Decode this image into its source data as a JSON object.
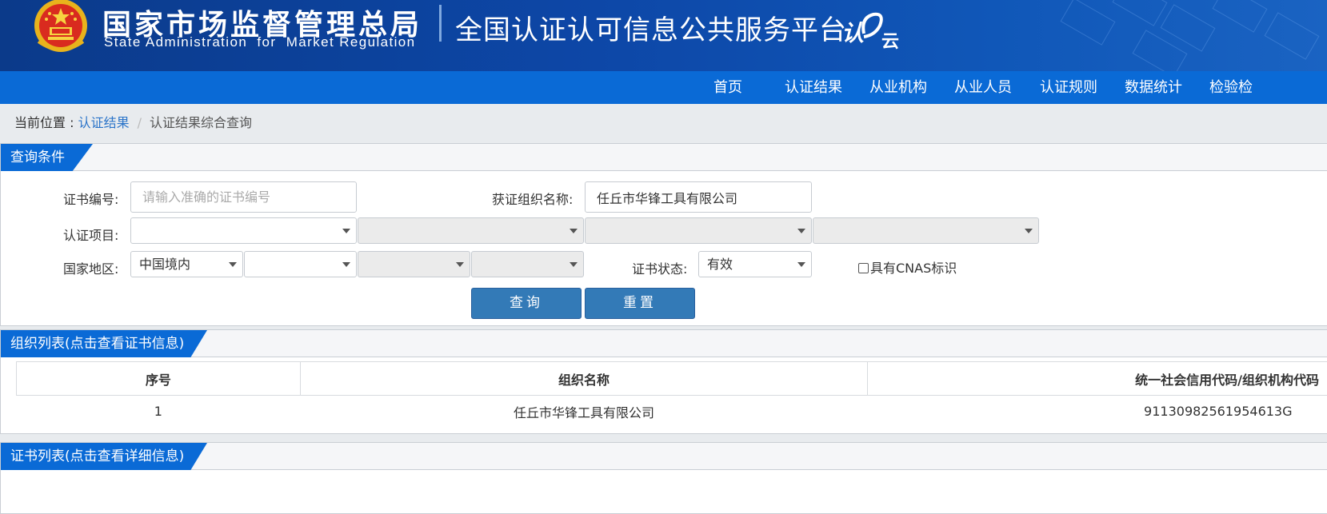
{
  "header": {
    "agency_cn": "国家市场监督管理总局",
    "agency_en": "State Administration  for  Market Regulation",
    "platform_title": "全国认证认可信息公共服务平台",
    "logo_text_1": "认",
    "logo_text_2": "云",
    "emblem_icon": "national-emblem-icon"
  },
  "nav": {
    "items": [
      "首页",
      "认证结果",
      "从业机构",
      "从业人员",
      "认证规则",
      "数据统计",
      "检验检"
    ]
  },
  "breadcrumb": {
    "prefix": "当前位置 : ",
    "link": "认证结果",
    "separator": "/",
    "current": "认证结果综合查询"
  },
  "query_panel": {
    "title": "查询条件",
    "cert_no_label": "证书编号:",
    "cert_no_placeholder": "请输入准确的证书编号",
    "org_name_label": "获证组织名称:",
    "org_name_value": "任丘市华锋工具有限公司",
    "project_label": "认证项目:",
    "project_selects": [
      "",
      "",
      "",
      ""
    ],
    "region_label": "国家地区:",
    "region_selects": [
      "中国境内",
      "",
      "",
      ""
    ],
    "status_label": "证书状态:",
    "status_value": "有效",
    "cnas_label": "具有CNAS标识",
    "query_button": "查询",
    "reset_button": "重置"
  },
  "org_panel": {
    "title": "组织列表(点击查看证书信息)",
    "columns": [
      "序号",
      "组织名称",
      "统一社会信用代码/组织机构代码"
    ],
    "rows": [
      [
        "1",
        "任丘市华锋工具有限公司",
        "91130982561954613G"
      ]
    ]
  },
  "cert_panel": {
    "title": "证书列表(点击查看详细信息)"
  },
  "colors": {
    "header_bg": "#0d47a7",
    "nav_bg": "#0a6ad6",
    "button_bg": "#337ab7",
    "link": "#2b74c9"
  }
}
